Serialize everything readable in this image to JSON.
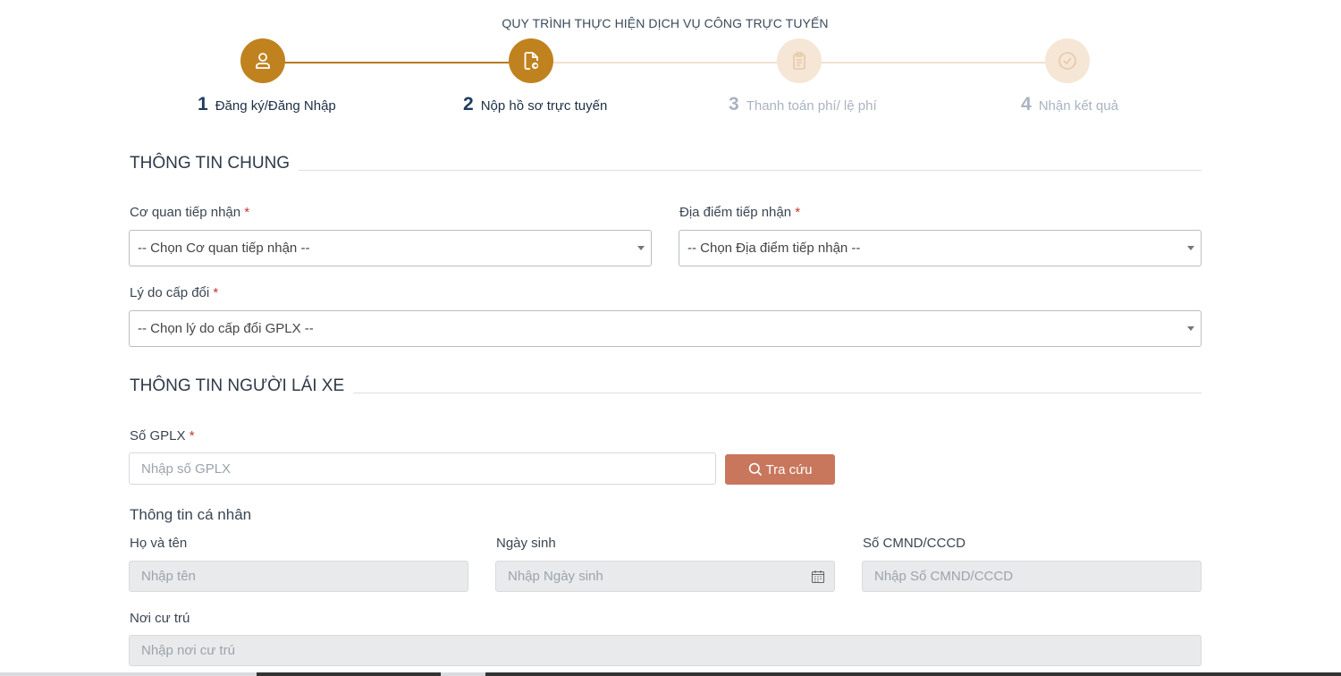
{
  "process": {
    "title": "QUY TRÌNH THỰC HIỆN DỊCH VỤ CÔNG TRỰC TUYẾN",
    "steps": [
      {
        "num": "1",
        "label": "Đăng ký/Đăng Nhập",
        "icon": "user-icon",
        "state": "active"
      },
      {
        "num": "2",
        "label": "Nộp hồ sơ trực tuyến",
        "icon": "file-submit-icon",
        "state": "active"
      },
      {
        "num": "3",
        "label": "Thanh toán phí/ lệ phí",
        "icon": "clipboard-icon",
        "state": "inactive"
      },
      {
        "num": "4",
        "label": "Nhận kết quả",
        "icon": "check-circle-icon",
        "state": "inactive"
      }
    ]
  },
  "general": {
    "heading": "THÔNG TIN CHUNG",
    "agency_label": "Cơ quan tiếp nhận",
    "agency_value": "-- Chọn Cơ quan tiếp nhận --",
    "location_label": "Địa điểm tiếp nhận",
    "location_value": "-- Chọn Địa điểm tiếp nhận --",
    "reason_label": "Lý do cấp đổi",
    "reason_value": "-- Chọn lý do cấp đổi GPLX --",
    "required_mark": "*"
  },
  "driver": {
    "heading": "THÔNG TIN NGƯỜI LÁI XE",
    "license_label": "Số GPLX",
    "license_placeholder": "Nhập số GPLX",
    "search_button": "Tra cứu",
    "personal_heading": "Thông tin cá nhân",
    "name_label": "Họ và tên",
    "name_placeholder": "Nhập tên",
    "dob_label": "Ngày sinh",
    "dob_placeholder": "Nhập Ngày sinh",
    "id_label": "Số CMND/CCCD",
    "id_placeholder": "Nhập Số CMND/CCCD",
    "residence_label": "Nơi cư trú",
    "residence_placeholder": "Nhập nơi cư trú"
  },
  "colors": {
    "step_active": "#c0821f",
    "step_inactive": "#f5e6d6",
    "search_button": "#c8775c",
    "required": "#c0392b"
  }
}
